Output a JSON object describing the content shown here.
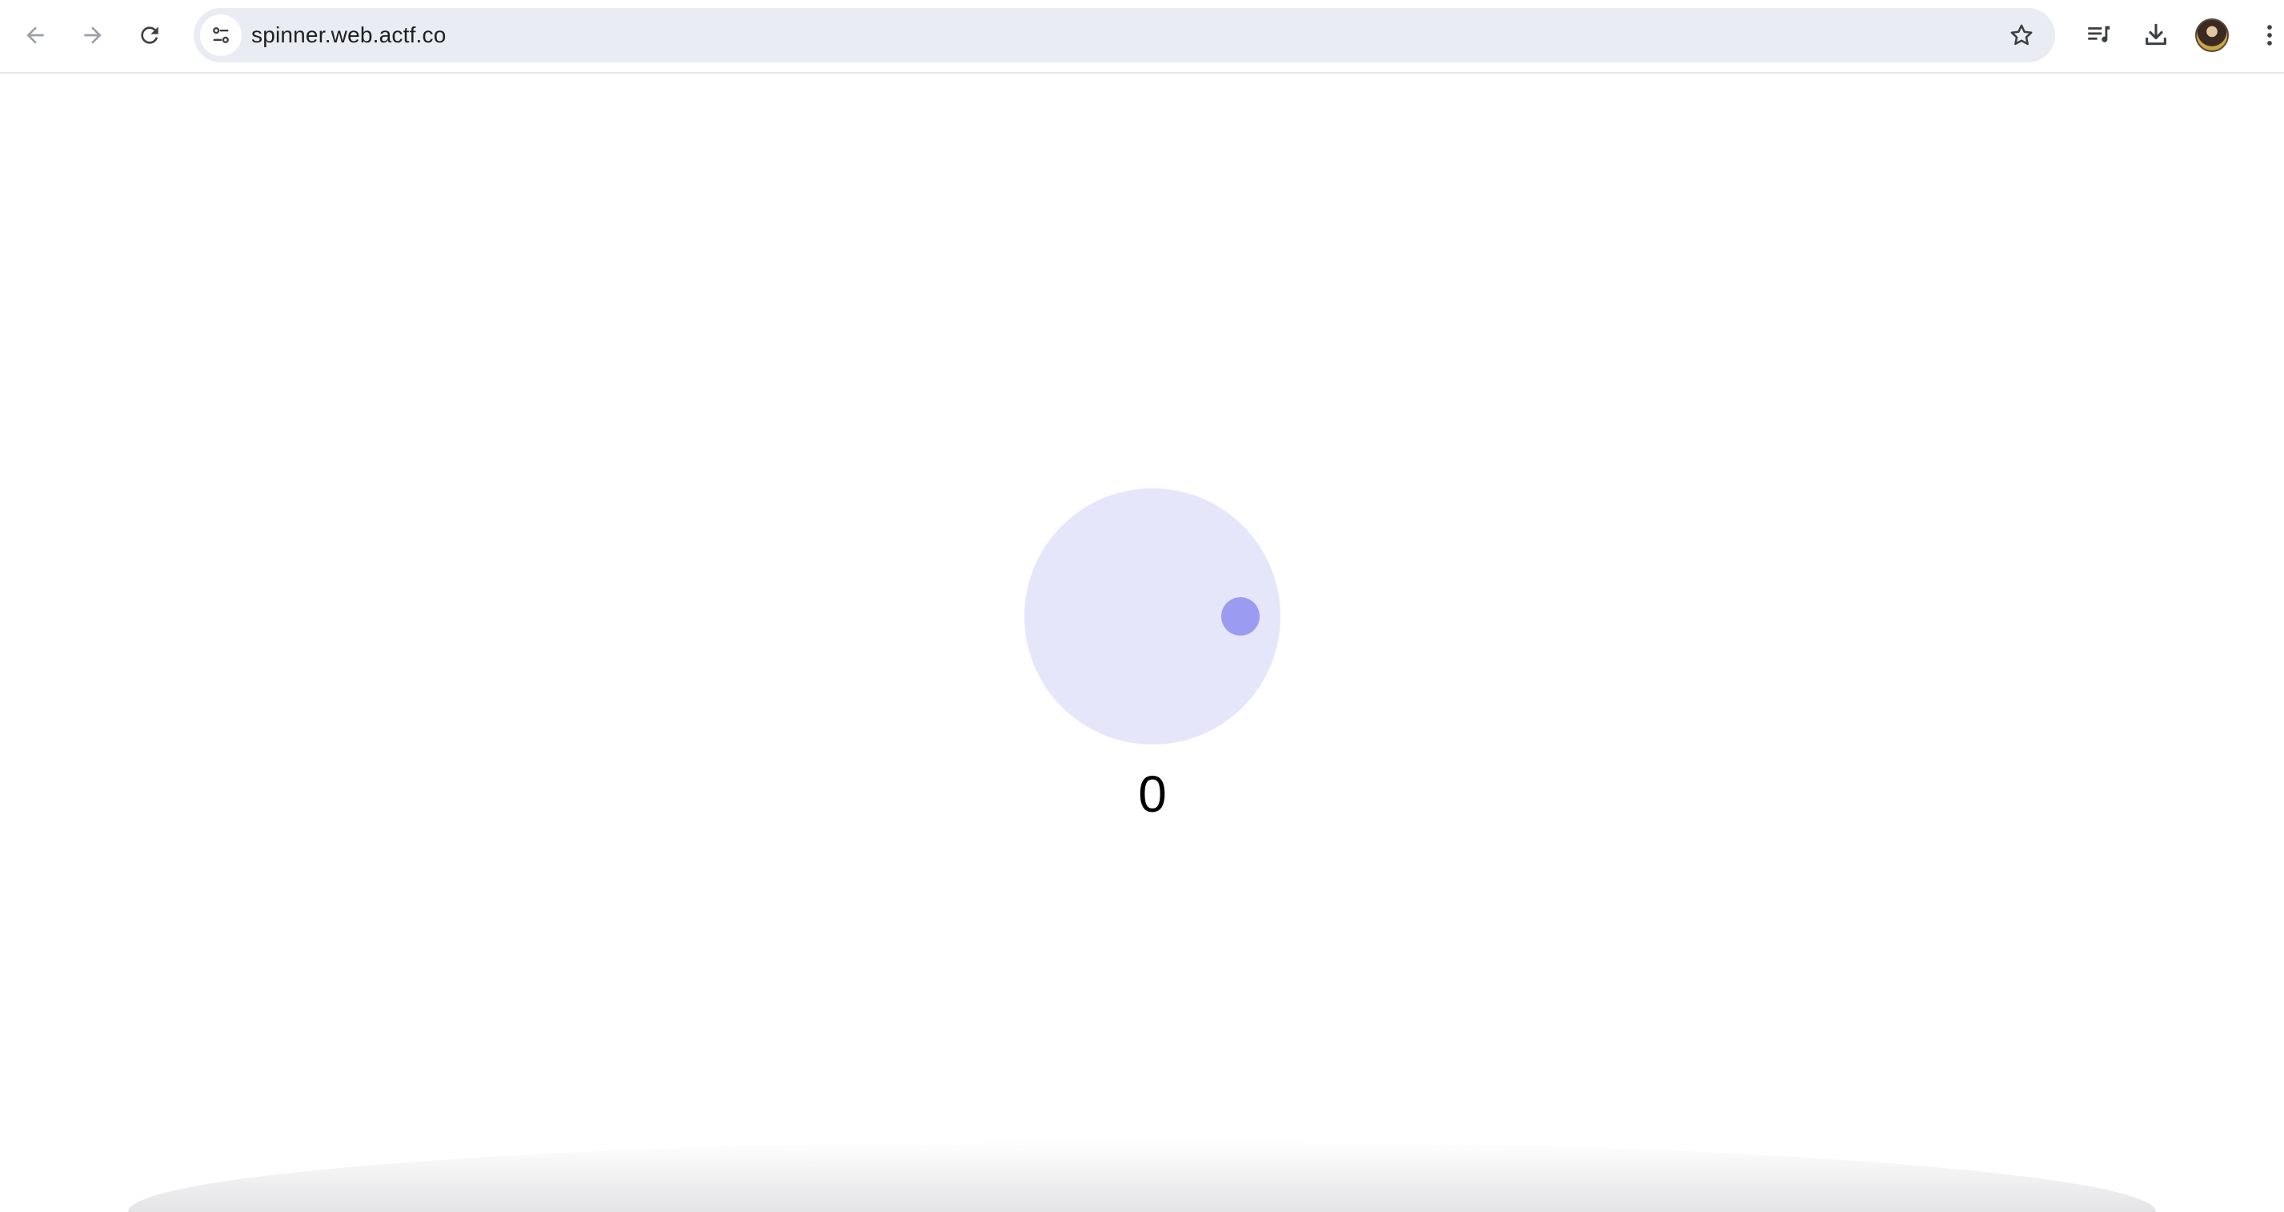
{
  "browser": {
    "url": "spinner.web.actf.co",
    "icons": {
      "back": "arrow-left-icon",
      "forward": "arrow-right-icon",
      "reload": "reload-icon",
      "site_info": "tune-icon",
      "bookmark": "star-icon",
      "reading_list": "reading-list-icon",
      "download": "download-icon",
      "menu": "more-vert-icon"
    }
  },
  "page": {
    "counter": "0"
  },
  "colors": {
    "spinner_track": "#e6e6fa",
    "spinner_knob": "#9b9bf2",
    "omnibox": "#e9ecf3"
  }
}
